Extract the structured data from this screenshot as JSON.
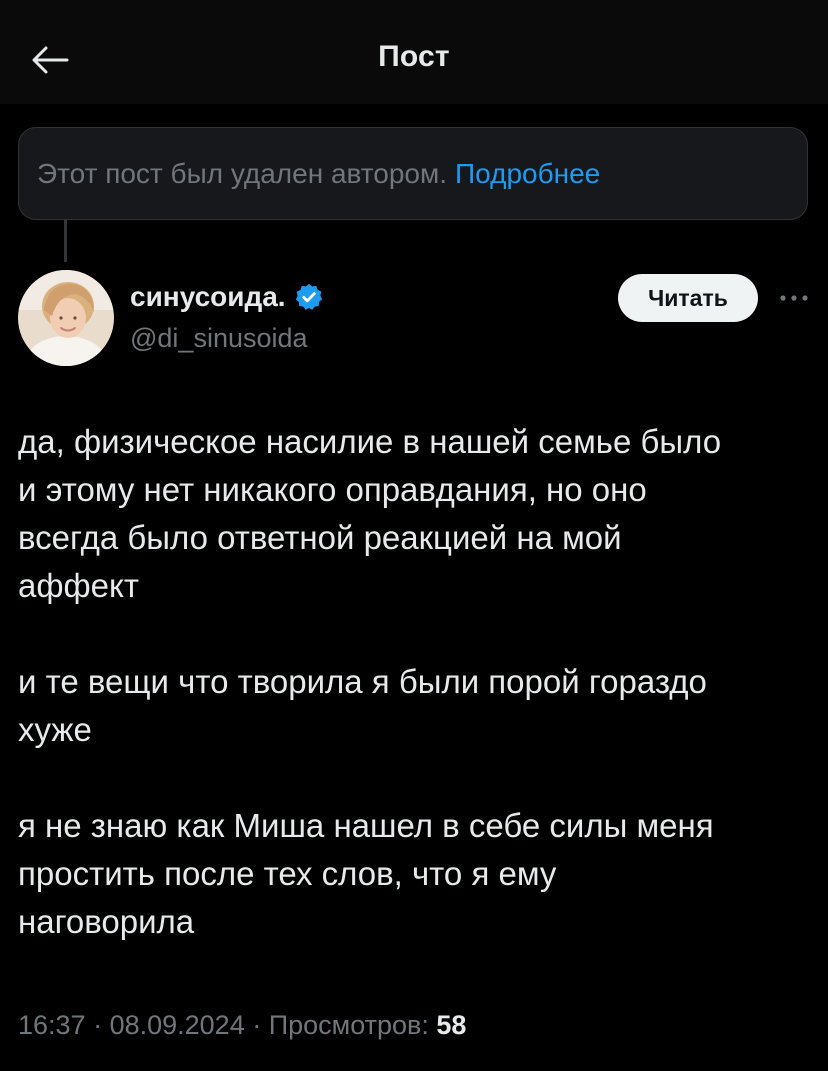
{
  "header": {
    "title": "Пост",
    "back_icon": "arrow-left-icon"
  },
  "deleted_notice": {
    "text": "Этот пост был удален автором.",
    "link_text": "Подробнее"
  },
  "author": {
    "name": "синусоида.",
    "handle": "@di_sinusoida",
    "verified_icon": "verified-badge-icon",
    "avatar_icon": "avatar"
  },
  "actions": {
    "follow_label": "Читать",
    "more_icon": "more-dots-icon"
  },
  "post": {
    "paragraphs": [
      "да, физическое насилие в нашей семье было\nи этому нет никакого оправдания, но оно\nвсегда было ответной реакцией на мой\nаффект",
      "и те вещи что творила я были порой гораздо\nхуже",
      "я не знаю как Миша нашел в себе силы меня\nпростить после тех слов, что я ему\nнаговорила"
    ]
  },
  "meta": {
    "time": "16:37",
    "separator": " · ",
    "date": "08.09.2024",
    "views_label": "Просмотров:",
    "views_count": "58"
  },
  "colors": {
    "background": "#000000",
    "text_primary": "#e7e9ea",
    "text_secondary": "#71767b",
    "link": "#1d9bf0",
    "verified": "#1d9bf0",
    "follow_bg": "#eff3f4"
  }
}
